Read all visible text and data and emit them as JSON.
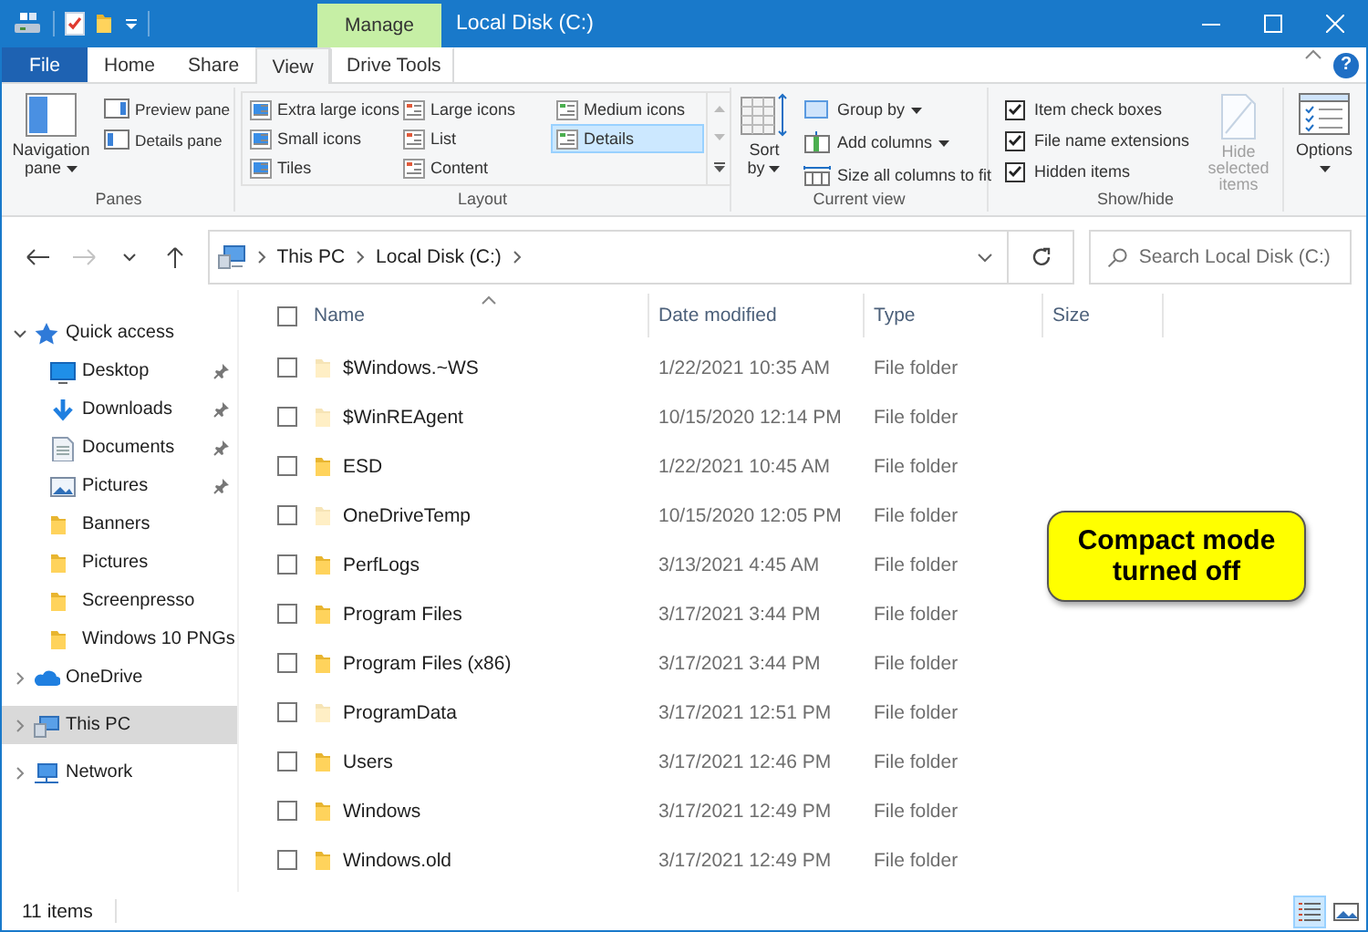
{
  "title_bar": {
    "contextual_tab": "Manage",
    "title": "Local Disk (C:)"
  },
  "tab_bar": {
    "tabs": [
      {
        "label": "File",
        "kind": "backstage",
        "selected": false
      },
      {
        "label": "Home",
        "kind": "tab",
        "selected": false
      },
      {
        "label": "Share",
        "kind": "tab",
        "selected": false
      },
      {
        "label": "View",
        "kind": "tab",
        "selected": true
      },
      {
        "label": "Drive Tools",
        "kind": "contextual",
        "selected": false
      }
    ],
    "help": "?"
  },
  "ribbon": {
    "panes": {
      "label": "Panes",
      "navigation_pane": "Navigation pane",
      "buttons": [
        "Preview pane",
        "Details pane"
      ]
    },
    "layout": {
      "label": "Layout",
      "options": [
        {
          "label": "Extra large icons",
          "selected": false
        },
        {
          "label": "Large icons",
          "selected": false
        },
        {
          "label": "Medium icons",
          "selected": false
        },
        {
          "label": "Small icons",
          "selected": false
        },
        {
          "label": "List",
          "selected": false
        },
        {
          "label": "Details",
          "selected": true
        },
        {
          "label": "Tiles",
          "selected": false
        },
        {
          "label": "Content",
          "selected": false
        }
      ]
    },
    "current_view": {
      "label": "Current view",
      "sort_by": "Sort by",
      "commands": [
        {
          "label": "Group by",
          "dropdown": true
        },
        {
          "label": "Add columns",
          "dropdown": true
        },
        {
          "label": "Size all columns to fit",
          "dropdown": false
        }
      ]
    },
    "show_hide": {
      "label": "Show/hide",
      "checkboxes": [
        {
          "label": "Item check boxes",
          "checked": true
        },
        {
          "label": "File name extensions",
          "checked": true
        },
        {
          "label": "Hidden items",
          "checked": true
        }
      ],
      "hide_selected": {
        "label": "Hide selected items",
        "disabled": true
      }
    },
    "options": {
      "label": "Options"
    }
  },
  "nav_buttons": [
    {
      "kind": "back",
      "disabled": false
    },
    {
      "kind": "forward",
      "disabled": true
    },
    {
      "kind": "recent",
      "disabled": false
    },
    {
      "kind": "up",
      "disabled": false
    }
  ],
  "address": {
    "path": [
      "This PC",
      "Local Disk (C:)"
    ]
  },
  "search": {
    "placeholder": "Search Local Disk (C:)"
  },
  "sidebar": {
    "items": [
      {
        "label": "Quick access",
        "kind": "quick-access",
        "expanded": true,
        "selected": false,
        "children": [
          {
            "label": "Desktop",
            "kind": "desktop",
            "pinned": true,
            "selected": false
          },
          {
            "label": "Downloads",
            "kind": "downloads",
            "pinned": true,
            "selected": false
          },
          {
            "label": "Documents",
            "kind": "documents",
            "pinned": true,
            "selected": false
          },
          {
            "label": "Pictures",
            "kind": "pictures",
            "pinned": true,
            "selected": false
          },
          {
            "label": "Banners",
            "kind": "folder",
            "pinned": false,
            "selected": false
          },
          {
            "label": "Pictures",
            "kind": "folder",
            "pinned": false,
            "selected": false
          },
          {
            "label": "Screenpresso",
            "kind": "folder",
            "pinned": false,
            "selected": false
          },
          {
            "label": "Windows 10 PNGs",
            "kind": "folder",
            "pinned": false,
            "selected": false
          }
        ]
      },
      {
        "label": "OneDrive",
        "kind": "onedrive",
        "expanded": false,
        "selected": false
      },
      {
        "label": "This PC",
        "kind": "pc",
        "expanded": false,
        "selected": true
      },
      {
        "label": "Network",
        "kind": "network",
        "expanded": false,
        "selected": false
      }
    ]
  },
  "file_list": {
    "header_checkbox": {
      "checked": false
    },
    "columns": [
      {
        "label": "Name",
        "sorted": true
      },
      {
        "label": "Date modified",
        "sorted": false
      },
      {
        "label": "Type",
        "sorted": false
      },
      {
        "label": "Size",
        "sorted": false
      }
    ],
    "rows": [
      {
        "name": "$Windows.~WS",
        "date": "1/22/2021 10:35 AM",
        "type": "File folder",
        "hidden": true,
        "checked": false
      },
      {
        "name": "$WinREAgent",
        "date": "10/15/2020 12:14 PM",
        "type": "File folder",
        "hidden": true,
        "checked": false
      },
      {
        "name": "ESD",
        "date": "1/22/2021 10:45 AM",
        "type": "File folder",
        "hidden": false,
        "checked": false
      },
      {
        "name": "OneDriveTemp",
        "date": "10/15/2020 12:05 PM",
        "type": "File folder",
        "hidden": true,
        "checked": false
      },
      {
        "name": "PerfLogs",
        "date": "3/13/2021 4:45 AM",
        "type": "File folder",
        "hidden": false,
        "checked": false
      },
      {
        "name": "Program Files",
        "date": "3/17/2021 3:44 PM",
        "type": "File folder",
        "hidden": false,
        "checked": false
      },
      {
        "name": "Program Files (x86)",
        "date": "3/17/2021 3:44 PM",
        "type": "File folder",
        "hidden": false,
        "checked": false
      },
      {
        "name": "ProgramData",
        "date": "3/17/2021 12:51 PM",
        "type": "File folder",
        "hidden": true,
        "checked": false
      },
      {
        "name": "Users",
        "date": "3/17/2021 12:46 PM",
        "type": "File folder",
        "hidden": false,
        "checked": false
      },
      {
        "name": "Windows",
        "date": "3/17/2021 12:49 PM",
        "type": "File folder",
        "hidden": false,
        "checked": false
      },
      {
        "name": "Windows.old",
        "date": "3/17/2021 12:49 PM",
        "type": "File folder",
        "hidden": false,
        "checked": false
      }
    ]
  },
  "status_bar": {
    "item_count": "11 items",
    "views": [
      {
        "kind": "details",
        "selected": true
      },
      {
        "kind": "large-icons",
        "selected": false
      }
    ]
  },
  "callout": {
    "text": "Compact mode turned off"
  }
}
